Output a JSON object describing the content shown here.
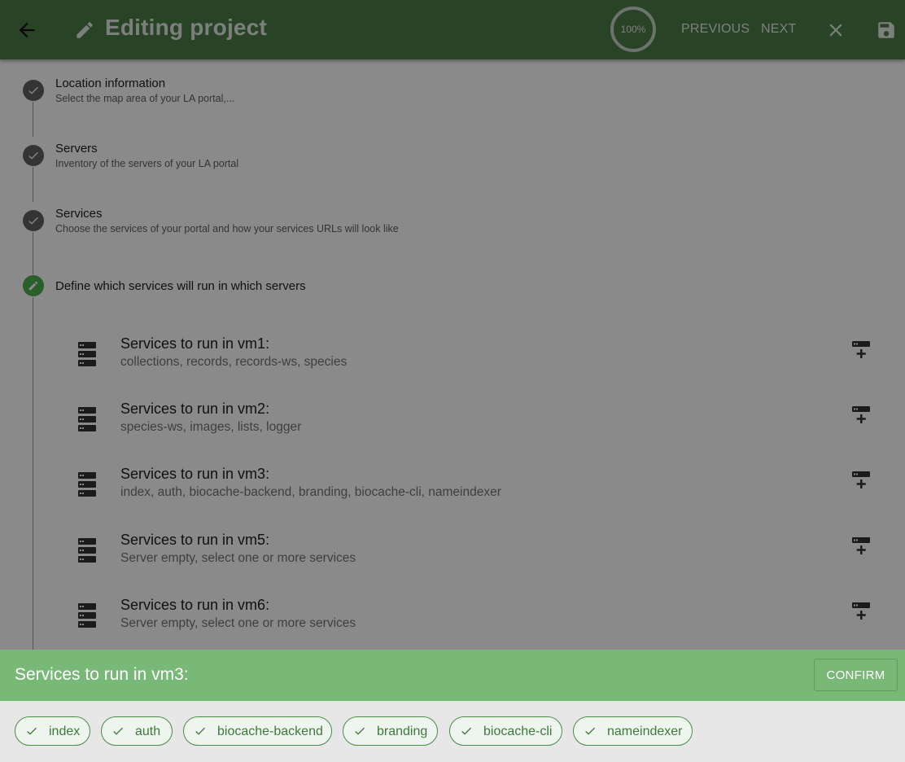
{
  "appbar": {
    "title": "Editing project",
    "progress_percent": 100,
    "progress_label": "100%",
    "previous_label": "PREVIOUS",
    "next_label": "NEXT",
    "icons": [
      "arrow-back-icon",
      "pencil-icon",
      "close-icon",
      "save-icon"
    ],
    "bg_color": "#4c7d47"
  },
  "steps": [
    {
      "title": "Location information",
      "subtitle": "Select the map area of your LA portal,...",
      "state": "done"
    },
    {
      "title": "Servers",
      "subtitle": "Inventory of the servers of your LA portal",
      "state": "done"
    },
    {
      "title": "Services",
      "subtitle": "Choose the services of your portal and how your services URLs will look like",
      "state": "done"
    },
    {
      "title": "Define which services will run in which servers",
      "state": "active"
    }
  ],
  "servers": [
    {
      "title": "Services to run in vm1:",
      "services": "collections, records, records-ws, species"
    },
    {
      "title": "Services to run in vm2:",
      "services": "species-ws, images, lists, logger"
    },
    {
      "title": "Services to run in vm3:",
      "services": "index, auth, biocache-backend, branding, biocache-cli, nameindexer"
    },
    {
      "title": "Services to run in vm5:",
      "services": "Server empty, select one or more services"
    },
    {
      "title": "Services to run in vm6:",
      "services": "Server empty, select one or more services"
    }
  ],
  "sheet": {
    "title": "Services to run in vm3:",
    "confirm_label": "CONFIRM",
    "header_color": "#79b978",
    "chips": [
      {
        "label": "index",
        "selected": true
      },
      {
        "label": "auth",
        "selected": true
      },
      {
        "label": "biocache-backend",
        "selected": true
      },
      {
        "label": "branding",
        "selected": true
      },
      {
        "label": "biocache-cli",
        "selected": true
      },
      {
        "label": "nameindexer",
        "selected": true
      }
    ]
  }
}
